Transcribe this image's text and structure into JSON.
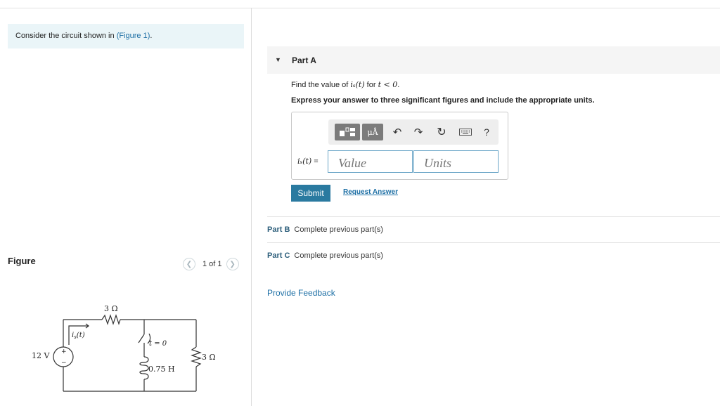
{
  "problem": {
    "text": "Consider the circuit shown in ",
    "link": "(Figure 1)",
    "suffix": "."
  },
  "figure": {
    "label": "Figure",
    "pager": "1 of 1",
    "prev_icon": "chevron-left-icon",
    "next_icon": "chevron-right-icon"
  },
  "circuit": {
    "r1_label": "3 Ω",
    "r2_label": "3 Ω",
    "source_label": "12 V",
    "current_label": "i",
    "current_sub": "s",
    "current_arg": "(t)",
    "switch_label": "t = 0",
    "inductor_label": "0.75 H",
    "plus_sign": "+",
    "minus_sign": "−"
  },
  "partA": {
    "title": "Part A",
    "question_prefix": "Find the value of ",
    "question_math": "iₛ(t)",
    "question_mid": " for ",
    "question_cond": "t < 0",
    "question_end": ".",
    "instruction": "Express your answer to three significant figures and include the appropriate units.",
    "answer_label_math": "iₛ(t)",
    "answer_label_eq": " =",
    "value_placeholder": "Value",
    "units_placeholder": "Units",
    "submit": "Submit",
    "request_answer": "Request Answer",
    "toolbar": {
      "template_icon": "template-icon",
      "units_button": "μÅ",
      "undo_icon": "undo-icon",
      "redo_icon": "redo-icon",
      "reset_icon": "reset-icon",
      "keyboard_icon": "keyboard-icon",
      "help": "?"
    }
  },
  "partB": {
    "title": "Part B",
    "status": "Complete previous part(s)"
  },
  "partC": {
    "title": "Part C",
    "status": "Complete previous part(s)"
  },
  "feedback": "Provide Feedback"
}
